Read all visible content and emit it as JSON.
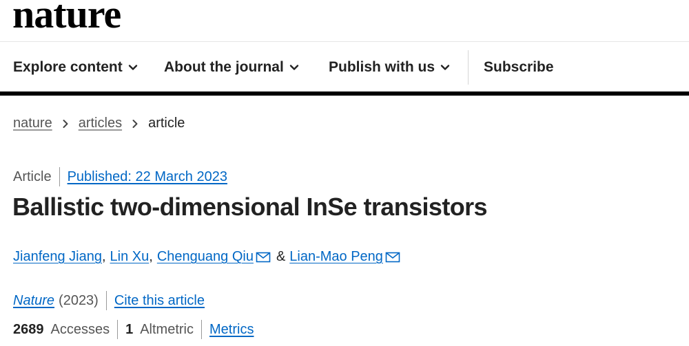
{
  "brand": {
    "logo_text": "nature"
  },
  "nav": {
    "items": [
      {
        "label": "Explore content",
        "has_dropdown": true
      },
      {
        "label": "About the journal",
        "has_dropdown": true
      },
      {
        "label": "Publish with us",
        "has_dropdown": true
      },
      {
        "label": "Subscribe",
        "has_dropdown": false
      }
    ]
  },
  "breadcrumb": {
    "items": [
      {
        "label": "nature",
        "link": true
      },
      {
        "label": "articles",
        "link": true
      },
      {
        "label": "article",
        "link": false
      }
    ]
  },
  "article": {
    "type": "Article",
    "published": "Published: 22 March 2023",
    "title": "Ballistic two-dimensional InSe transistors",
    "authors": [
      {
        "name": "Jianfeng Jiang",
        "email_icon": false,
        "trailing": ","
      },
      {
        "name": "Lin Xu",
        "email_icon": false,
        "trailing": ","
      },
      {
        "name": "Chenguang Qiu",
        "email_icon": true,
        "trailing": ""
      },
      {
        "name": "Lian-Mao Peng",
        "email_icon": true,
        "trailing": ""
      }
    ],
    "authors_joiner": "&",
    "journal_name": "Nature",
    "journal_year": "(2023)",
    "cite_label": "Cite this article",
    "accesses_count": "2689",
    "accesses_label": "Accesses",
    "altmetric_count": "1",
    "altmetric_label": "Altmetric",
    "metrics_label": "Metrics"
  },
  "colors": {
    "link": "#0067c5",
    "text": "#222222",
    "muted": "#555555",
    "rule": "#000000"
  },
  "icons": {
    "dropdown": "chevron-down-icon",
    "breadcrumb_separator": "chevron-right-icon",
    "author_contact": "envelope-icon"
  }
}
